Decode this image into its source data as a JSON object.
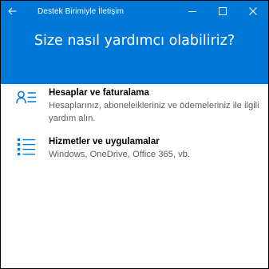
{
  "window": {
    "title": "Destek Birimiyle İletişim",
    "accent_color": "#0078d7",
    "back_icon": "back-arrow-icon",
    "minimize_icon": "minimize-icon",
    "maximize_icon": "maximize-icon",
    "close_icon": "close-icon"
  },
  "page": {
    "heading": "Size nasıl yardımcı olabiliriz?"
  },
  "options": [
    {
      "icon": "person-list-icon",
      "title": "Hesaplar ve faturalama",
      "description": "Hesaplarınız, aboneleikleriniz ve ödemeleriniz ile ilgili yardım alın."
    },
    {
      "icon": "bulleted-list-icon",
      "title": "Hizmetler ve uygulamalar",
      "description": "Windows, OneDrive, Office 365, vb."
    }
  ]
}
